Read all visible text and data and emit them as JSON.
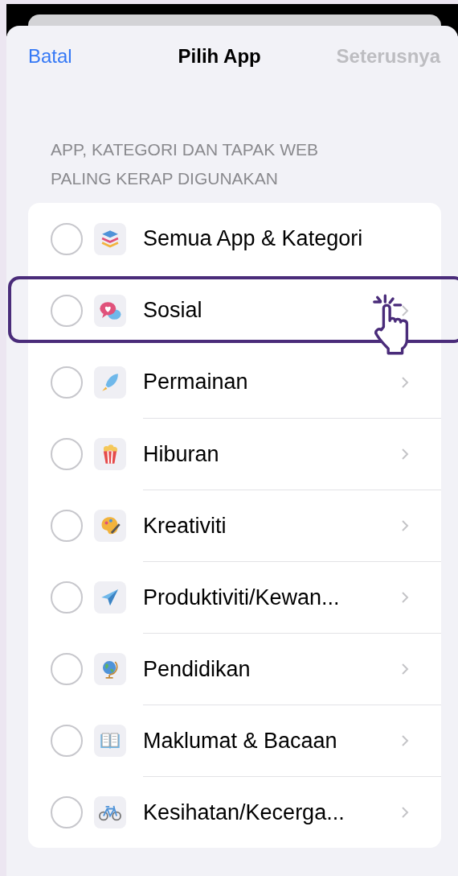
{
  "nav": {
    "cancel": "Batal",
    "title": "Pilih App",
    "next": "Seterusnya",
    "next_disabled": true
  },
  "section_header": "APP, KATEGORI DAN TAPAK WEB PALING KERAP DIGUNAKAN",
  "items": [
    {
      "label": "Semua App & Kategori",
      "selected": false,
      "chevron": false,
      "highlighted": false
    },
    {
      "label": "Sosial",
      "selected": false,
      "chevron": true,
      "highlighted": true
    },
    {
      "label": "Permainan",
      "selected": false,
      "chevron": true,
      "highlighted": false
    },
    {
      "label": "Hiburan",
      "selected": false,
      "chevron": true,
      "highlighted": false
    },
    {
      "label": "Kreativiti",
      "selected": false,
      "chevron": true,
      "highlighted": false
    },
    {
      "label": "Produktiviti/Kewan...",
      "selected": false,
      "chevron": true,
      "highlighted": false
    },
    {
      "label": "Pendidikan",
      "selected": false,
      "chevron": true,
      "highlighted": false
    },
    {
      "label": "Maklumat & Bacaan",
      "selected": false,
      "chevron": true,
      "highlighted": false
    },
    {
      "label": "Kesihatan/Kecerga...",
      "selected": false,
      "chevron": true,
      "highlighted": false
    }
  ]
}
